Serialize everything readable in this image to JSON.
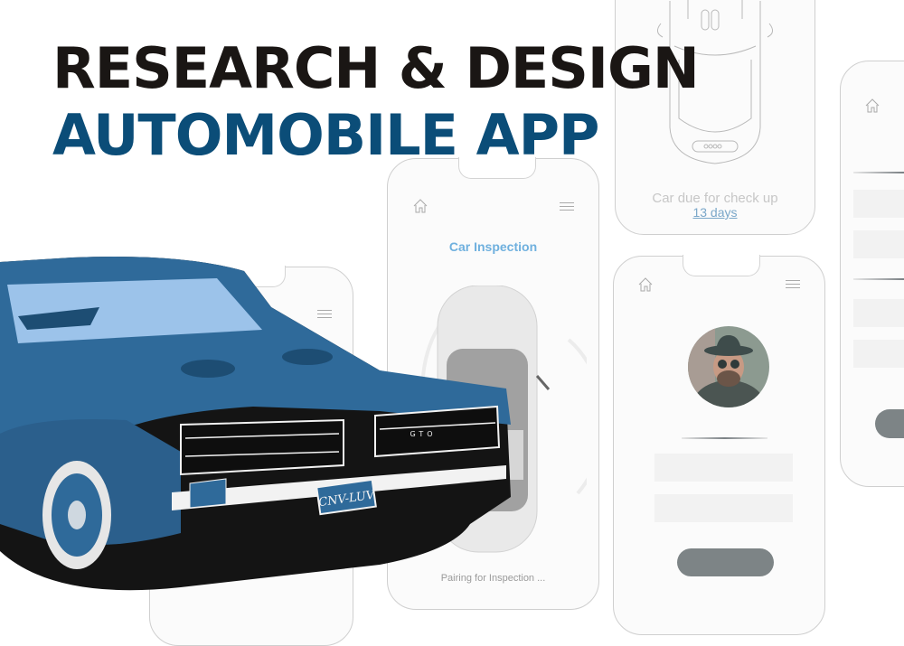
{
  "headline": {
    "line1": "RESEARCH & DESIGN",
    "line2": "AUTOMOBILE APP"
  },
  "colors": {
    "headline_dark": "#1a1614",
    "headline_accent": "#0b4d78",
    "screen_title": "#6fb0de",
    "link": "#7aa7c9",
    "button": "#7d8486",
    "car_body": "#2f6a9a"
  },
  "screens": {
    "top_view": {
      "status_label": "Car due for check up",
      "days_link": "13 days"
    },
    "inspection": {
      "title": "Car Inspection",
      "footer_status": "Pairing for Inspection ..."
    },
    "profile": {
      "field_count": 2
    },
    "settings": {
      "field_count": 4
    }
  },
  "hero_car": {
    "license_plate": "CNV-LUV",
    "grille_badge": "GTO"
  },
  "icons": {
    "home": "home-icon",
    "menu": "hamburger-menu-icon"
  }
}
